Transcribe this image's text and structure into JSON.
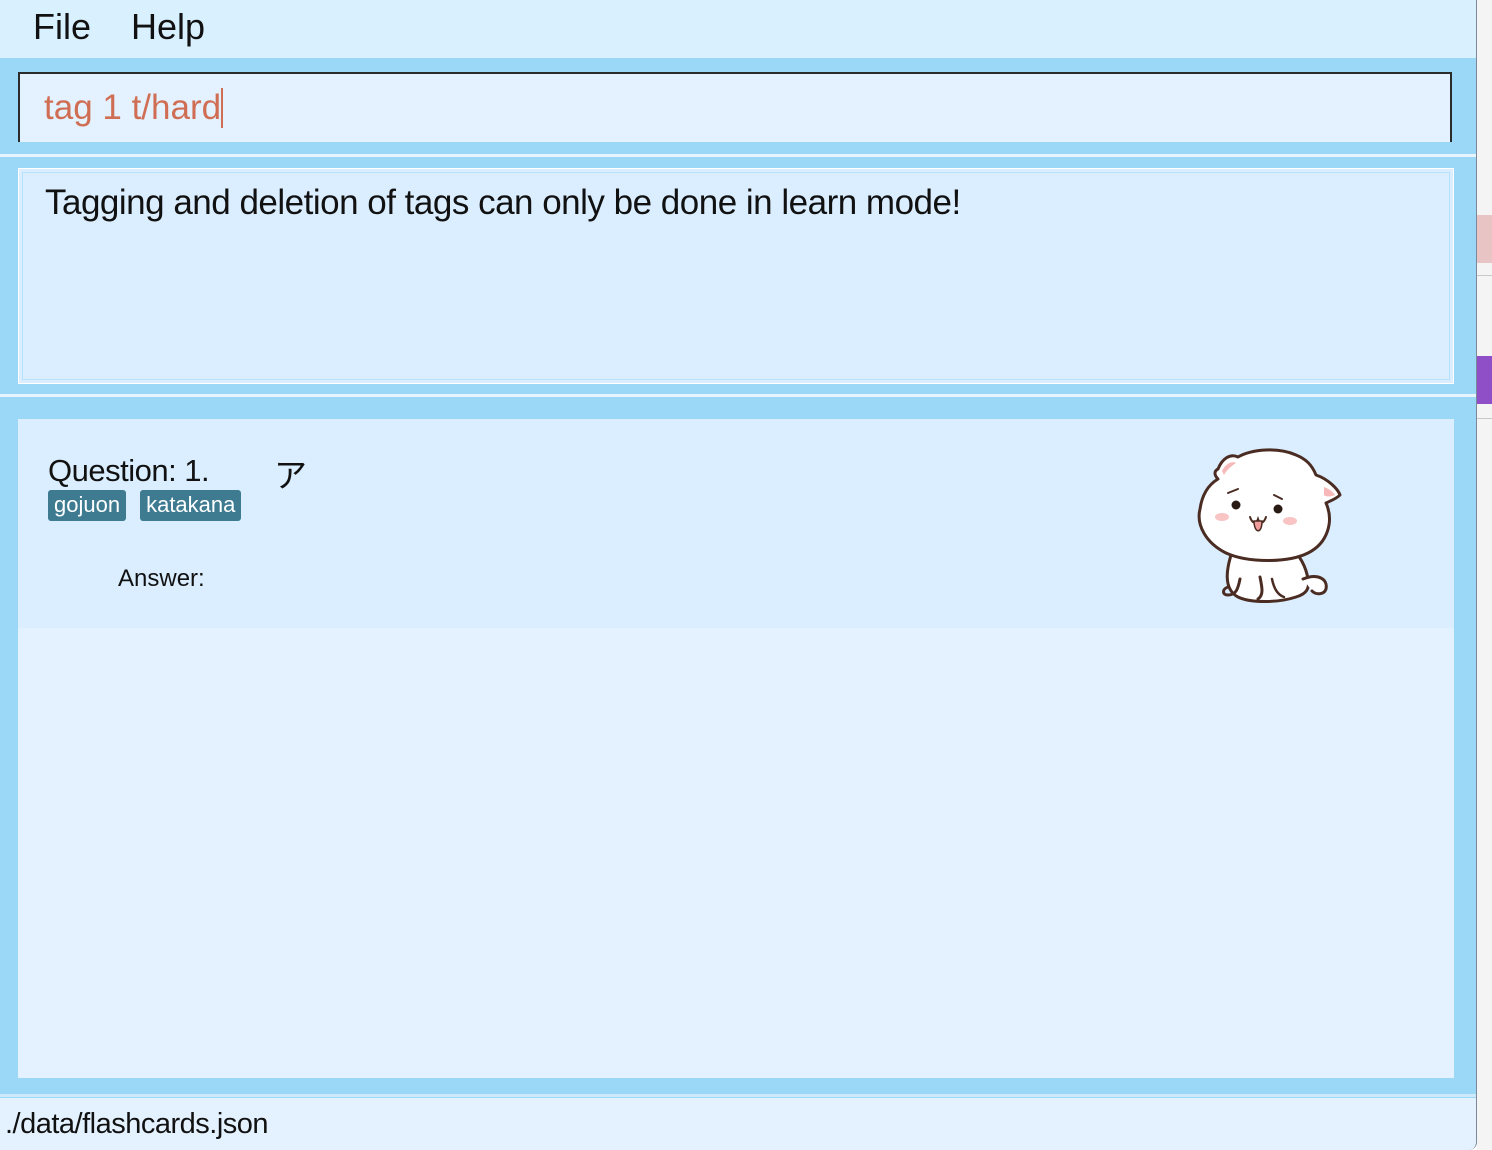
{
  "menu": {
    "file_label": "File",
    "help_label": "Help"
  },
  "command_box": {
    "value": "tag 1 t/hard"
  },
  "result_display": {
    "message": "Tagging and deletion of tags can only be done in learn mode!"
  },
  "flashcard": {
    "question_label": "Question: 1.",
    "question_char": "ア",
    "tags": [
      "gojuon",
      "katakana"
    ],
    "answer_label": "Answer:",
    "mascot_icon": "cat-mascot-icon"
  },
  "status_bar": {
    "file_path": "./data/flashcards.json"
  },
  "colors": {
    "pane_background": "#9bd8f8",
    "menubar_background": "#d9f0ff",
    "command_text": "#d06e54",
    "tag_background": "#3e7b91"
  }
}
